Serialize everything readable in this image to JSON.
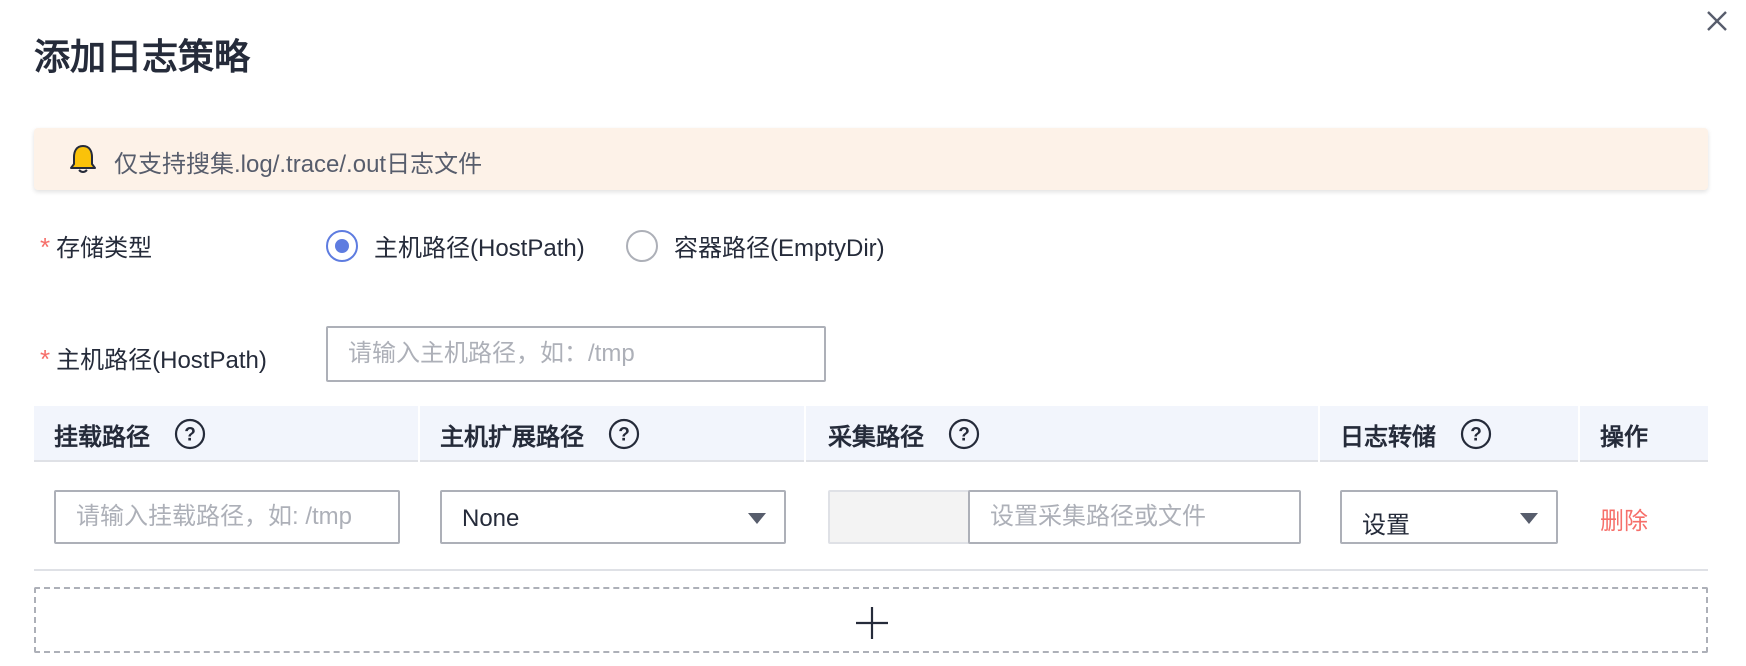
{
  "dialog": {
    "title": "添加日志策略",
    "close_icon": "close-icon"
  },
  "alert": {
    "icon": "bell-icon",
    "text": "仅支持搜集.log/.trace/.out日志文件"
  },
  "storage_type": {
    "label": "存储类型",
    "required_mark": "*",
    "options": [
      {
        "label": "主机路径(HostPath)",
        "selected": true
      },
      {
        "label": "容器路径(EmptyDir)",
        "selected": false
      }
    ]
  },
  "host_path": {
    "label": "主机路径(HostPath)",
    "required_mark": "*",
    "placeholder": "请输入主机路径，如：/tmp",
    "value": ""
  },
  "table": {
    "columns": [
      {
        "label": "挂载路径",
        "help": true
      },
      {
        "label": "主机扩展路径",
        "help": true
      },
      {
        "label": "采集路径",
        "help": true
      },
      {
        "label": "日志转储",
        "help": true
      },
      {
        "label": "操作",
        "help": false
      }
    ],
    "rows": [
      {
        "mount_path_placeholder": "请输入挂载路径，如: /tmp",
        "host_ext_path_value": "None",
        "collect_path_placeholder": "设置采集路径或文件",
        "log_dump_value": "设置",
        "action_label": "删除"
      }
    ]
  },
  "add_row": {
    "icon": "plus-icon"
  },
  "colors": {
    "accent": "#5e7ce0",
    "danger": "#f66f6a",
    "alert_bg": "#fdf2e8",
    "table_head_bg": "#f2f5fc",
    "border": "#adb0b8"
  }
}
